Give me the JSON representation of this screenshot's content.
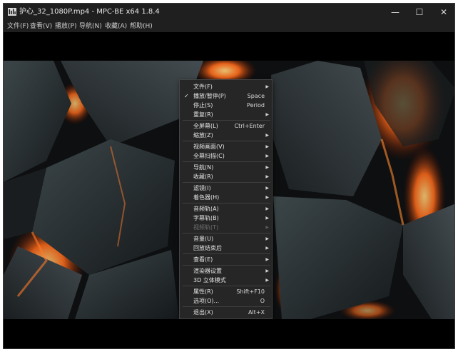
{
  "window": {
    "title": "护心_32_1080P.mp4 - MPC-BE x64 1.8.4",
    "controls": {
      "minimize": "—",
      "maximize": "☐",
      "close": "✕"
    }
  },
  "menubar": {
    "items": [
      "文件(F)",
      "查看(V)",
      "播放(P)",
      "导航(N)",
      "收藏(A)",
      "帮助(H)"
    ]
  },
  "context_menu": {
    "items": [
      {
        "label": "文件(F)",
        "shortcut": "",
        "submenu": true,
        "checked": false,
        "disabled": false
      },
      {
        "label": "播放/暂停(P)",
        "shortcut": "Space",
        "submenu": false,
        "checked": true,
        "disabled": false
      },
      {
        "label": "停止(S)",
        "shortcut": "Period",
        "submenu": false,
        "checked": false,
        "disabled": false
      },
      {
        "label": "重复(R)",
        "shortcut": "",
        "submenu": true,
        "checked": false,
        "disabled": false
      },
      {
        "label": "全屏幕(L)",
        "shortcut": "Ctrl+Enter",
        "submenu": false,
        "checked": false,
        "disabled": false
      },
      {
        "label": "缩放(Z)",
        "shortcut": "",
        "submenu": true,
        "checked": false,
        "disabled": false
      },
      {
        "label": "视频画面(V)",
        "shortcut": "",
        "submenu": true,
        "checked": false,
        "disabled": false
      },
      {
        "label": "全幕扫描(C)",
        "shortcut": "",
        "submenu": true,
        "checked": false,
        "disabled": false
      },
      {
        "label": "导航(N)",
        "shortcut": "",
        "submenu": true,
        "checked": false,
        "disabled": false
      },
      {
        "label": "收藏(R)",
        "shortcut": "",
        "submenu": true,
        "checked": false,
        "disabled": false
      },
      {
        "label": "滤镜(I)",
        "shortcut": "",
        "submenu": true,
        "checked": false,
        "disabled": false
      },
      {
        "label": "着色器(H)",
        "shortcut": "",
        "submenu": true,
        "checked": false,
        "disabled": false
      },
      {
        "label": "音频轨(A)",
        "shortcut": "",
        "submenu": true,
        "checked": false,
        "disabled": false
      },
      {
        "label": "字幕轨(B)",
        "shortcut": "",
        "submenu": true,
        "checked": false,
        "disabled": false
      },
      {
        "label": "视频轨(T)",
        "shortcut": "",
        "submenu": true,
        "checked": false,
        "disabled": true
      },
      {
        "label": "音量(U)",
        "shortcut": "",
        "submenu": true,
        "checked": false,
        "disabled": false
      },
      {
        "label": "回放结束后",
        "shortcut": "",
        "submenu": true,
        "checked": false,
        "disabled": false
      },
      {
        "label": "查看(E)",
        "shortcut": "",
        "submenu": true,
        "checked": false,
        "disabled": false
      },
      {
        "label": "渲染器设置",
        "shortcut": "",
        "submenu": true,
        "checked": false,
        "disabled": false
      },
      {
        "label": "3D 立体模式",
        "shortcut": "",
        "submenu": true,
        "checked": false,
        "disabled": false
      },
      {
        "label": "属性(R)",
        "shortcut": "Shift+F10",
        "submenu": false,
        "checked": false,
        "disabled": false
      },
      {
        "label": "选项(O)...",
        "shortcut": "O",
        "submenu": false,
        "checked": false,
        "disabled": false
      },
      {
        "label": "退出(X)",
        "shortcut": "Alt+X",
        "submenu": false,
        "checked": false,
        "disabled": false
      }
    ]
  },
  "colors": {
    "titlebar": "#1f1f1f",
    "menu_bg": "#262626",
    "text": "#e4e4e4",
    "lava": "#ff6a1a"
  },
  "icons": {
    "app": "film-icon",
    "submenu": "arrow-right-icon",
    "check": "check-icon"
  }
}
